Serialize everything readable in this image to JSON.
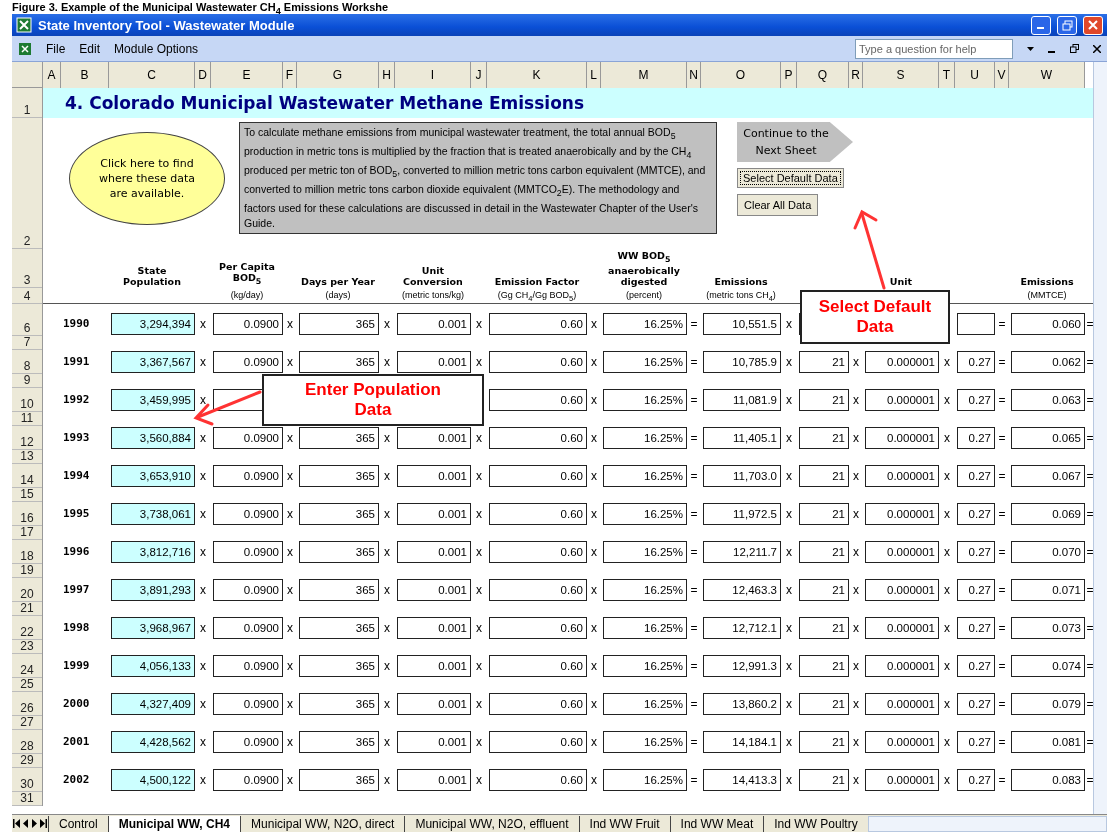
{
  "caption": "Figure 3. Example of the Municipal Wastewater CH$_{4}$ Emissions Workshe",
  "window": {
    "title": "State Inventory Tool - Wastewater Module"
  },
  "menu": [
    {
      "label": "File"
    },
    {
      "label": "Edit"
    },
    {
      "label": "Module Options"
    }
  ],
  "help_search": {
    "placeholder": "Type a question for help"
  },
  "column_letters": [
    "A",
    "B",
    "C",
    "D",
    "E",
    "F",
    "G",
    "H",
    "I",
    "J",
    "K",
    "L",
    "M",
    "N",
    "O",
    "P",
    "Q",
    "R",
    "S",
    "T",
    "U",
    "V",
    "W"
  ],
  "sheet": {
    "title_row_number": "1",
    "title": "4. Colorado Municipal Wastewater Methane Emissions",
    "info_row_number": "2",
    "info_bubble": "Click here to find where these data are available.",
    "description": "To calculate methane emissions from municipal wastewater treatment, the total annual BOD$_{5}$ production in metric tons is multiplied by the fraction that is treated anaerobically and by the CH$_{4}$ produced per metric ton of BOD$_{5}$, converted to million metric tons carbon equivalent (MMTCE), and converted to million metric tons carbon dioxide equivalent (MMTCO$_{2}$E).  The methodology and factors used for these calculations are discussed in detail in the Wastewater Chapter of the User's Guide.",
    "buttons": [
      {
        "kind": "arrow",
        "label": "Continue to the Next Sheet"
      },
      {
        "kind": "button",
        "label": "Select Default Data",
        "focused": true
      },
      {
        "kind": "button",
        "label": "Clear All Data",
        "focused": false
      }
    ],
    "header_row_numbers": [
      "3",
      "4"
    ],
    "headers": [
      {
        "title": "State Population"
      },
      {
        "title": "Per Capita BOD$_{5}$",
        "unit": "(kg/day)"
      },
      {
        "title": "Days per Year",
        "unit": "(days)"
      },
      {
        "title": "Unit Conversion",
        "unit": "(metric tons/kg)"
      },
      {
        "title": "Emission Factor",
        "unit": "(Gg CH$_{4}$/Gg BOD$_{5}$)"
      },
      {
        "title": "WW BOD$_{5}$ anaerobically digested",
        "unit": "(percent)"
      },
      {
        "title": "Emissions",
        "unit": "(metric tons CH$_{4}$)"
      },
      {
        "title": "Unit"
      },
      {
        "title": "Emissions",
        "unit": "(MMTCE)"
      }
    ],
    "rows": [
      {
        "kind": "right_covered",
        "row_numbers": [
          "6",
          "7"
        ],
        "year": "1990",
        "values": [
          "3,294,394",
          "0.0900",
          "365",
          "0.001",
          "0.60",
          "16.25%",
          "10,551.5",
          "0.060"
        ],
        "ops": [
          "x",
          "x",
          "x",
          "x",
          "x",
          "=",
          "x",
          "=",
          "="
        ]
      },
      {
        "kind": "full",
        "row_numbers": [
          "8",
          "9"
        ],
        "year": "1991",
        "values": [
          "3,367,567",
          "0.0900",
          "365",
          "0.001",
          "0.60",
          "16.25%",
          "10,785.9",
          "21",
          "0.000001",
          "0.27",
          "0.062"
        ],
        "ops": [
          "x",
          "x",
          "x",
          "x",
          "x",
          "=",
          "x",
          "x",
          "x",
          "=",
          "="
        ]
      },
      {
        "kind": "left_covered",
        "row_numbers": [
          "10",
          "11"
        ],
        "year": "1992",
        "values": [
          "3,459,995",
          "0.60",
          "16.25%",
          "11,081.9",
          "21",
          "0.000001",
          "0.27",
          "0.063"
        ],
        "ops": [
          "x",
          "x",
          "=",
          "x",
          "x",
          "x",
          "=",
          "="
        ]
      },
      {
        "kind": "full",
        "row_numbers": [
          "12",
          "13"
        ],
        "year": "1993",
        "values": [
          "3,560,884",
          "0.0900",
          "365",
          "0.001",
          "0.60",
          "16.25%",
          "11,405.1",
          "21",
          "0.000001",
          "0.27",
          "0.065"
        ],
        "ops": [
          "x",
          "x",
          "x",
          "x",
          "x",
          "=",
          "x",
          "x",
          "x",
          "=",
          "="
        ]
      },
      {
        "kind": "full",
        "row_numbers": [
          "14",
          "15"
        ],
        "year": "1994",
        "values": [
          "3,653,910",
          "0.0900",
          "365",
          "0.001",
          "0.60",
          "16.25%",
          "11,703.0",
          "21",
          "0.000001",
          "0.27",
          "0.067"
        ],
        "ops": [
          "x",
          "x",
          "x",
          "x",
          "x",
          "=",
          "x",
          "x",
          "x",
          "=",
          "="
        ]
      },
      {
        "kind": "full",
        "row_numbers": [
          "16",
          "17"
        ],
        "year": "1995",
        "values": [
          "3,738,061",
          "0.0900",
          "365",
          "0.001",
          "0.60",
          "16.25%",
          "11,972.5",
          "21",
          "0.000001",
          "0.27",
          "0.069"
        ],
        "ops": [
          "x",
          "x",
          "x",
          "x",
          "x",
          "=",
          "x",
          "x",
          "x",
          "=",
          "="
        ]
      },
      {
        "kind": "full",
        "row_numbers": [
          "18",
          "19"
        ],
        "year": "1996",
        "values": [
          "3,812,716",
          "0.0900",
          "365",
          "0.001",
          "0.60",
          "16.25%",
          "12,211.7",
          "21",
          "0.000001",
          "0.27",
          "0.070"
        ],
        "ops": [
          "x",
          "x",
          "x",
          "x",
          "x",
          "=",
          "x",
          "x",
          "x",
          "=",
          "="
        ]
      },
      {
        "kind": "full",
        "row_numbers": [
          "20",
          "21"
        ],
        "year": "1997",
        "values": [
          "3,891,293",
          "0.0900",
          "365",
          "0.001",
          "0.60",
          "16.25%",
          "12,463.3",
          "21",
          "0.000001",
          "0.27",
          "0.071"
        ],
        "ops": [
          "x",
          "x",
          "x",
          "x",
          "x",
          "=",
          "x",
          "x",
          "x",
          "=",
          "="
        ]
      },
      {
        "kind": "full",
        "row_numbers": [
          "22",
          "23"
        ],
        "year": "1998",
        "values": [
          "3,968,967",
          "0.0900",
          "365",
          "0.001",
          "0.60",
          "16.25%",
          "12,712.1",
          "21",
          "0.000001",
          "0.27",
          "0.073"
        ],
        "ops": [
          "x",
          "x",
          "x",
          "x",
          "x",
          "=",
          "x",
          "x",
          "x",
          "=",
          "="
        ]
      },
      {
        "kind": "full",
        "row_numbers": [
          "24",
          "25"
        ],
        "year": "1999",
        "values": [
          "4,056,133",
          "0.0900",
          "365",
          "0.001",
          "0.60",
          "16.25%",
          "12,991.3",
          "21",
          "0.000001",
          "0.27",
          "0.074"
        ],
        "ops": [
          "x",
          "x",
          "x",
          "x",
          "x",
          "=",
          "x",
          "x",
          "x",
          "=",
          "="
        ]
      },
      {
        "kind": "full",
        "row_numbers": [
          "26",
          "27"
        ],
        "year": "2000",
        "values": [
          "4,327,409",
          "0.0900",
          "365",
          "0.001",
          "0.60",
          "16.25%",
          "13,860.2",
          "21",
          "0.000001",
          "0.27",
          "0.079"
        ],
        "ops": [
          "x",
          "x",
          "x",
          "x",
          "x",
          "=",
          "x",
          "x",
          "x",
          "=",
          "="
        ]
      },
      {
        "kind": "full",
        "row_numbers": [
          "28",
          "29"
        ],
        "year": "2001",
        "values": [
          "4,428,562",
          "0.0900",
          "365",
          "0.001",
          "0.60",
          "16.25%",
          "14,184.1",
          "21",
          "0.000001",
          "0.27",
          "0.081"
        ],
        "ops": [
          "x",
          "x",
          "x",
          "x",
          "x",
          "=",
          "x",
          "x",
          "x",
          "=",
          "="
        ]
      },
      {
        "kind": "full",
        "row_numbers": [
          "30",
          "31"
        ],
        "year": "2002",
        "values": [
          "4,500,122",
          "0.0900",
          "365",
          "0.001",
          "0.60",
          "16.25%",
          "14,413.3",
          "21",
          "0.000001",
          "0.27",
          "0.083"
        ],
        "ops": [
          "x",
          "x",
          "x",
          "x",
          "x",
          "=",
          "x",
          "x",
          "x",
          "=",
          "="
        ]
      }
    ]
  },
  "callouts": [
    {
      "text": "Select Default Data"
    },
    {
      "text": "Enter Population Data"
    }
  ],
  "sheet_tabs": [
    {
      "label": "Control",
      "selected": false
    },
    {
      "label": "Municipal WW, CH4",
      "selected": true
    },
    {
      "label": "Municipal WW, N2O, direct",
      "selected": false
    },
    {
      "label": "Municipal WW, N2O, effluent",
      "selected": false
    },
    {
      "label": "Ind WW Fruit",
      "selected": false
    },
    {
      "label": "Ind WW Meat",
      "selected": false
    },
    {
      "label": "Ind WW Poultry",
      "selected": false
    }
  ]
}
